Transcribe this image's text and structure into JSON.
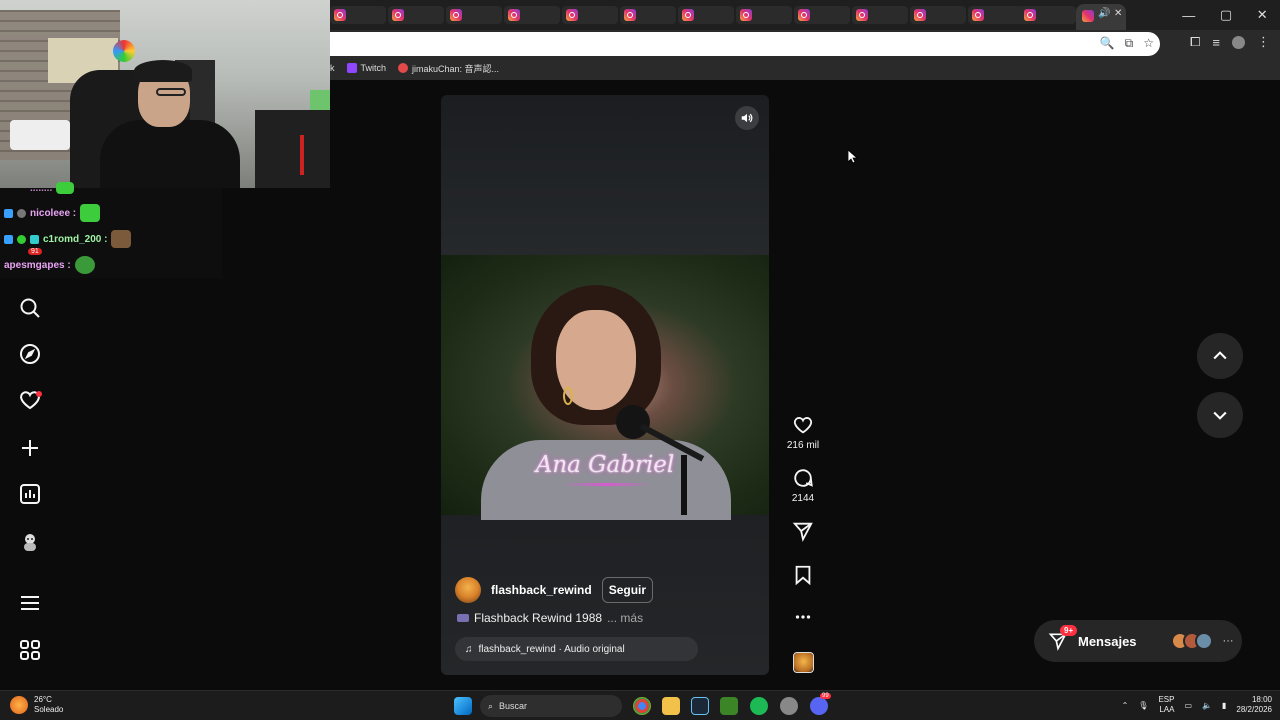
{
  "browser": {
    "tab_count": 13,
    "active_tab_index": 13,
    "bookmarks": [
      {
        "label": "k"
      },
      {
        "label": "Twitch",
        "color": "#9146ff"
      },
      {
        "label": "jimakuChan: 音声認...",
        "color": "#e24a4a"
      }
    ],
    "window_controls": [
      "—",
      "▢",
      "✕"
    ]
  },
  "chat": {
    "messages": [
      {
        "user": "nicoleee :",
        "color": "#e9a4f5"
      },
      {
        "user": "c1romd_200 :",
        "color": "#9ef3a6"
      },
      {
        "user": "apesmgapes :",
        "color": "#e9a4f5"
      }
    ],
    "badge_count": "91"
  },
  "ig_nav": {
    "items": [
      {
        "name": "search",
        "icon": "search-icon"
      },
      {
        "name": "explore",
        "icon": "compass-icon"
      },
      {
        "name": "notifications",
        "icon": "heart-icon"
      },
      {
        "name": "create",
        "icon": "plus-icon"
      },
      {
        "name": "dashboard",
        "icon": "chart-icon"
      },
      {
        "name": "threads",
        "icon": "threads-icon"
      },
      {
        "name": "more",
        "icon": "menu-icon"
      },
      {
        "name": "also-from-meta",
        "icon": "grid-icon"
      }
    ]
  },
  "reel": {
    "caption_overlay": "Ana Gabriel",
    "author": "flashback_rewind",
    "follow_label": "Seguir",
    "description": "Flashback Rewind 1988",
    "more_label": "... más",
    "audio": "flashback_rewind · Audio original",
    "likes": "216 mil",
    "comments": "2144"
  },
  "messages": {
    "label": "Mensajes",
    "badge": "9+",
    "more": "···"
  },
  "taskbar": {
    "temperature": "26°C",
    "condition": "Soleado",
    "search_placeholder": "Buscar",
    "lang_top": "ESP",
    "lang_bottom": "LAA",
    "time": "18:00",
    "date": "28/2/2026",
    "discord_badge": "99"
  },
  "colors": {
    "background": "#0b0b0b",
    "notification_red": "#ff3040",
    "ig_gradient": [
      "#f9a23c",
      "#e2336b",
      "#8b3bd6"
    ]
  }
}
